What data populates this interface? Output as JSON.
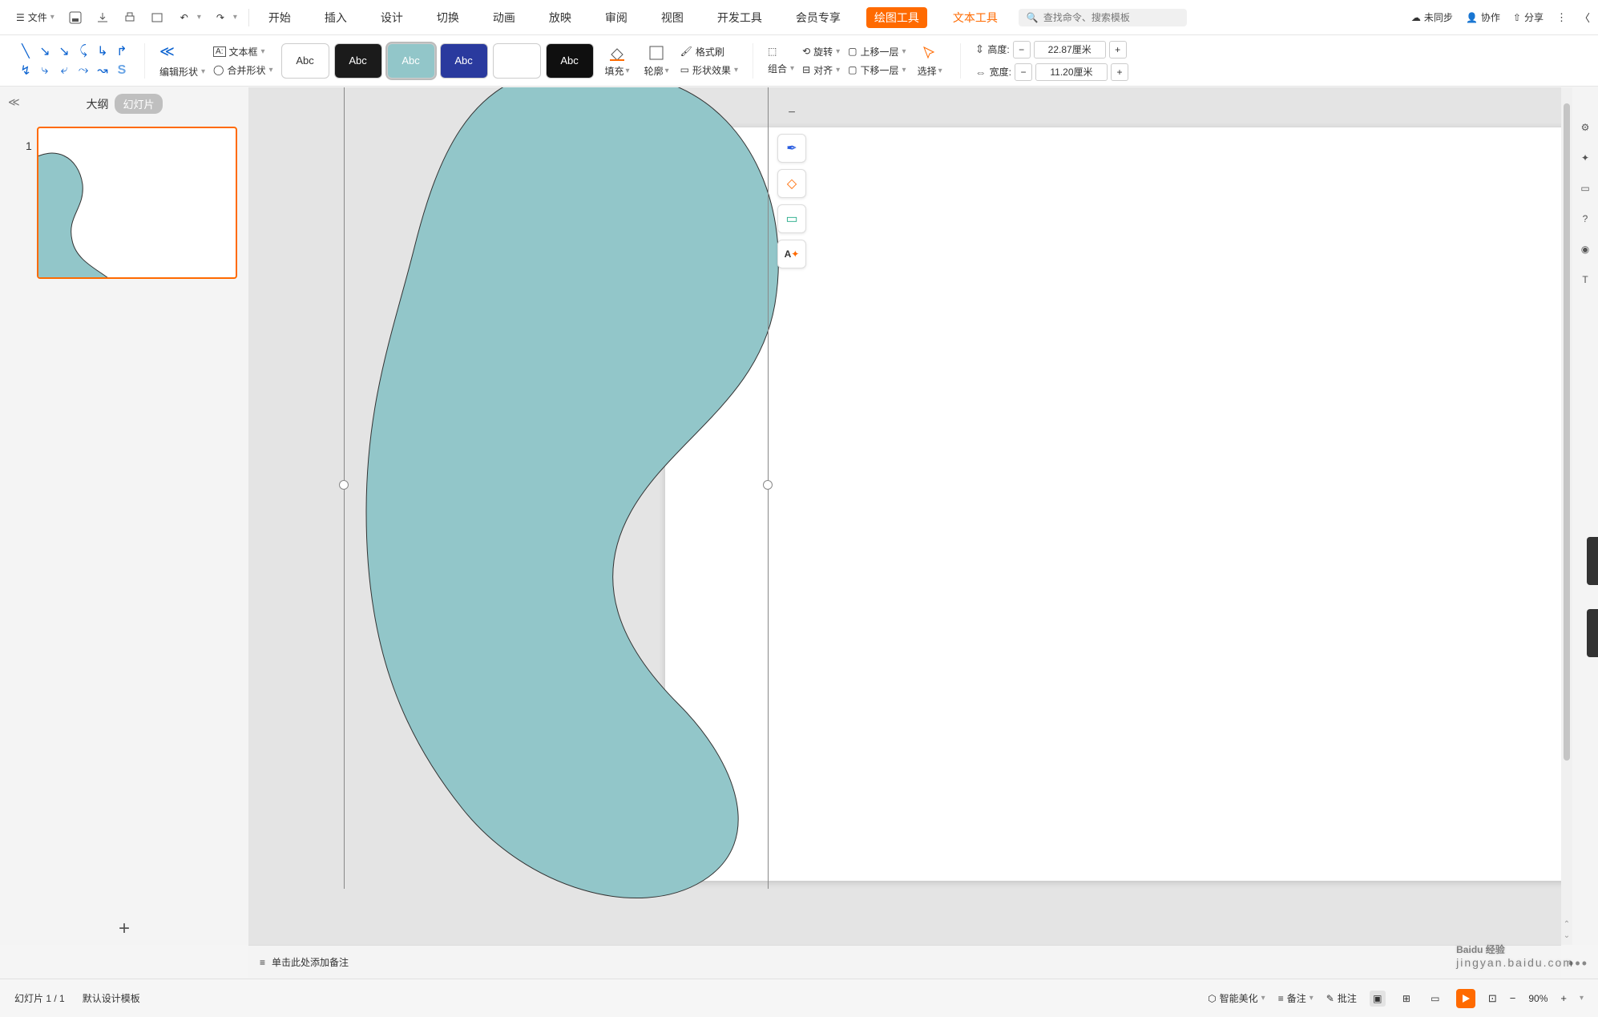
{
  "topbar": {
    "file": "文件",
    "sync": "未同步",
    "collab": "协作",
    "share": "分享"
  },
  "search": {
    "placeholder": "查找命令、搜索模板"
  },
  "menus": {
    "m1": "开始",
    "m2": "插入",
    "m3": "设计",
    "m4": "切换",
    "m5": "动画",
    "m6": "放映",
    "m7": "审阅",
    "m8": "视图",
    "m9": "开发工具",
    "m10": "会员专享",
    "ctx1": "绘图工具",
    "ctx2": "文本工具"
  },
  "ribbon": {
    "edit_shape": "编辑形状",
    "merge_shape": "合并形状",
    "textbox": "文本框",
    "preset_label": "Abc",
    "fill": "填充",
    "outline": "轮廓",
    "effects": "形状效果",
    "fmt_painter": "格式刷",
    "group": "组合",
    "rotate": "旋转",
    "align": "对齐",
    "bring_fwd": "上移一层",
    "send_back": "下移一层",
    "select": "选择",
    "height_l": "高度:",
    "height_v": "22.87厘米",
    "width_l": "宽度:",
    "width_v": "11.20厘米"
  },
  "panel": {
    "outline": "大纲",
    "slides": "幻灯片",
    "thumb_num": "1"
  },
  "notes": {
    "placeholder": "单击此处添加备注"
  },
  "status": {
    "count": "幻灯片 1 / 1",
    "template": "默认设计模板",
    "beautify": "智能美化",
    "notes": "备注",
    "comments": "批注",
    "zoom": "90%"
  },
  "watermark": {
    "main": "Baidu 经验",
    "sub": "jingyan.baidu.com"
  }
}
